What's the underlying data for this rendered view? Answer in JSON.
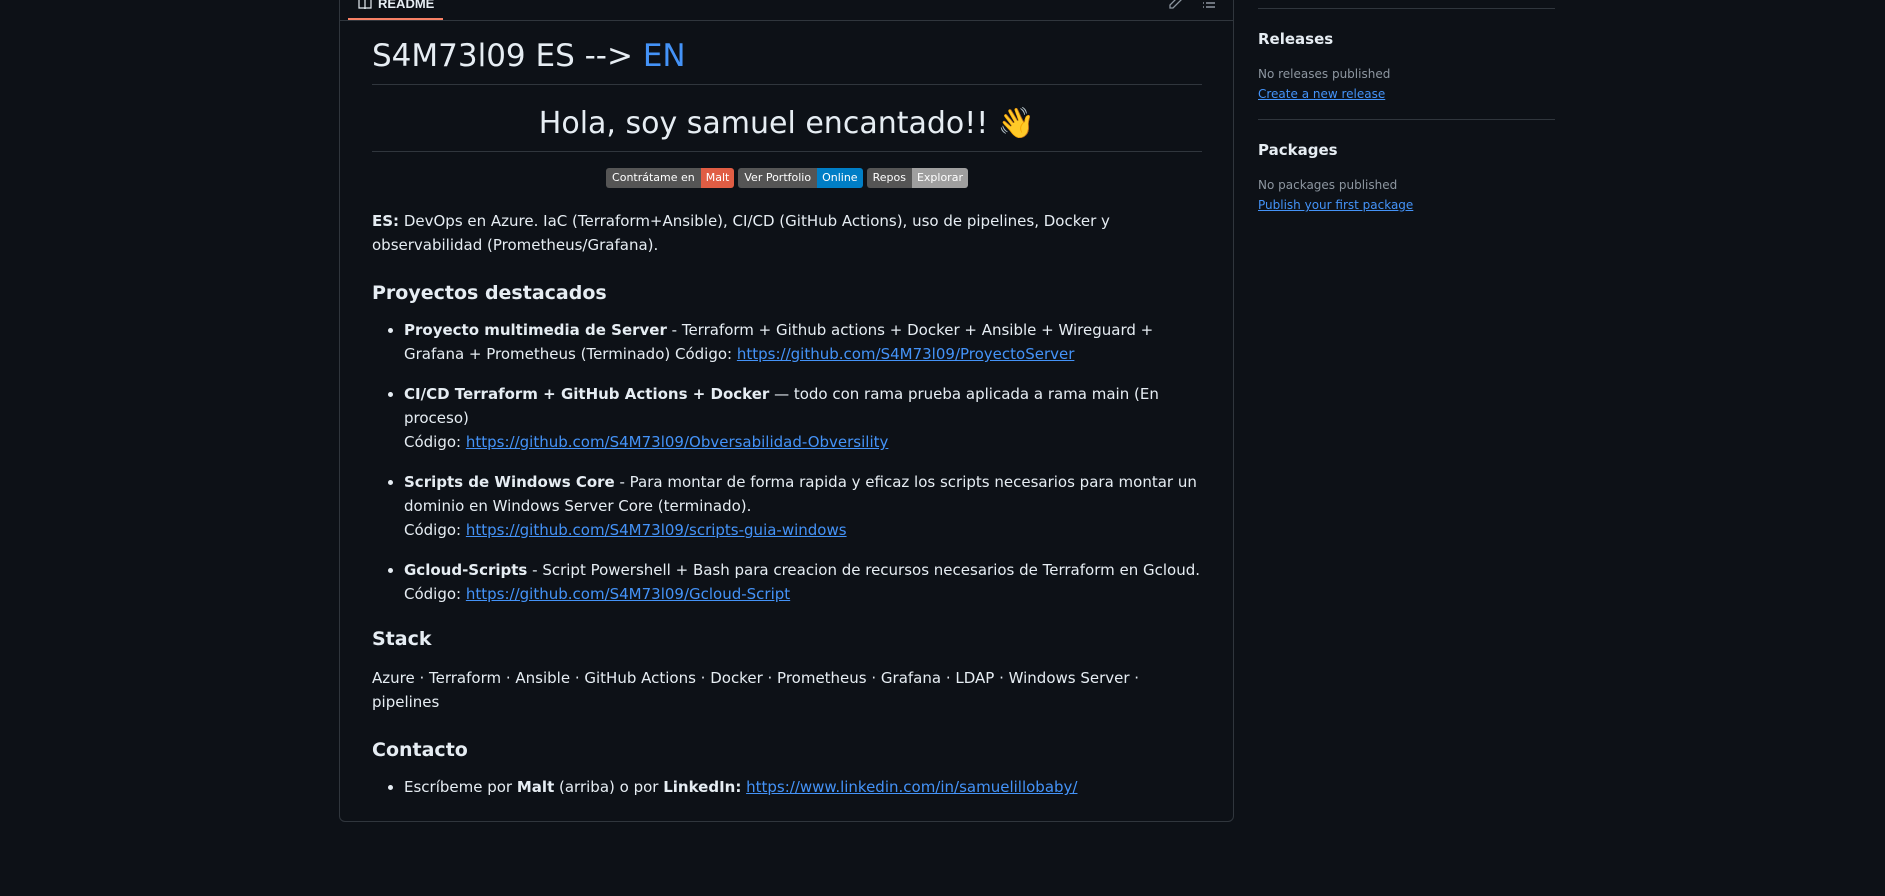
{
  "readme": {
    "tab_label": "README",
    "title_main": "S4M73l09 ES -->",
    "title_en": "EN",
    "greeting": "Hola, soy samuel encantado!! 👋",
    "badges": [
      {
        "left": "Contrátame en",
        "right": "Malt",
        "color": "#e05d44"
      },
      {
        "left": "Ver Portfolio",
        "right": "Online",
        "color": "#007ec6"
      },
      {
        "left": "Repos",
        "right": "Explorar",
        "color": "#9f9f9f"
      }
    ],
    "intro_label": "ES:",
    "intro_text": " DevOps en Azure. IaC (Terraform+Ansible), CI/CD (GitHub Actions), uso de pipelines, Docker y observabilidad (Prometheus/Grafana).",
    "projects_heading": "Proyectos destacados",
    "projects": [
      {
        "name": "Proyecto multimedia de Server",
        "desc": " - Terraform + Github actions + Docker + Ansible + Wireguard + Grafana + Prometheus (Terminado) Código: ",
        "link": "https://github.com/S4M73l09/ProyectoServer"
      },
      {
        "name": "CI/CD Terraform + GitHub Actions + Docker",
        "desc": " — todo con rama prueba aplicada a rama main (En proceso)",
        "code_label": "Código: ",
        "link": "https://github.com/S4M73l09/Obversabilidad-Obversility"
      },
      {
        "name": "Scripts de Windows Core",
        "desc": " - Para montar de forma rapida y eficaz los scripts necesarios para montar un dominio en Windows Server Core (terminado).",
        "code_label": "Código: ",
        "link": "https://github.com/S4M73l09/scripts-guia-windows"
      },
      {
        "name": "Gcloud-Scripts",
        "desc": " - Script Powershell + Bash para creacion de recursos necesarios de Terraform en Gcloud.",
        "code_label": "Código: ",
        "link": "https://github.com/S4M73l09/Gcloud-Script"
      }
    ],
    "stack_heading": "Stack",
    "stack_text": "Azure · Terraform · Ansible · GitHub Actions · Docker · Prometheus · Grafana · LDAP · Windows Server · pipelines",
    "contact_heading": "Contacto",
    "contact": {
      "pre": "Escríbeme por ",
      "malt": "Malt",
      "mid": " (arriba) o por ",
      "linkedin": "LinkedIn:",
      "link": "https://www.linkedin.com/in/samuelillobaby/"
    }
  },
  "sidebar": {
    "releases": {
      "title": "Releases",
      "muted": "No releases published",
      "link": "Create a new release"
    },
    "packages": {
      "title": "Packages",
      "muted": "No packages published",
      "link": "Publish your first package"
    }
  },
  "icons": {
    "readme_tab": "book-icon",
    "pencil": "pencil-icon",
    "toc": "list-icon"
  }
}
